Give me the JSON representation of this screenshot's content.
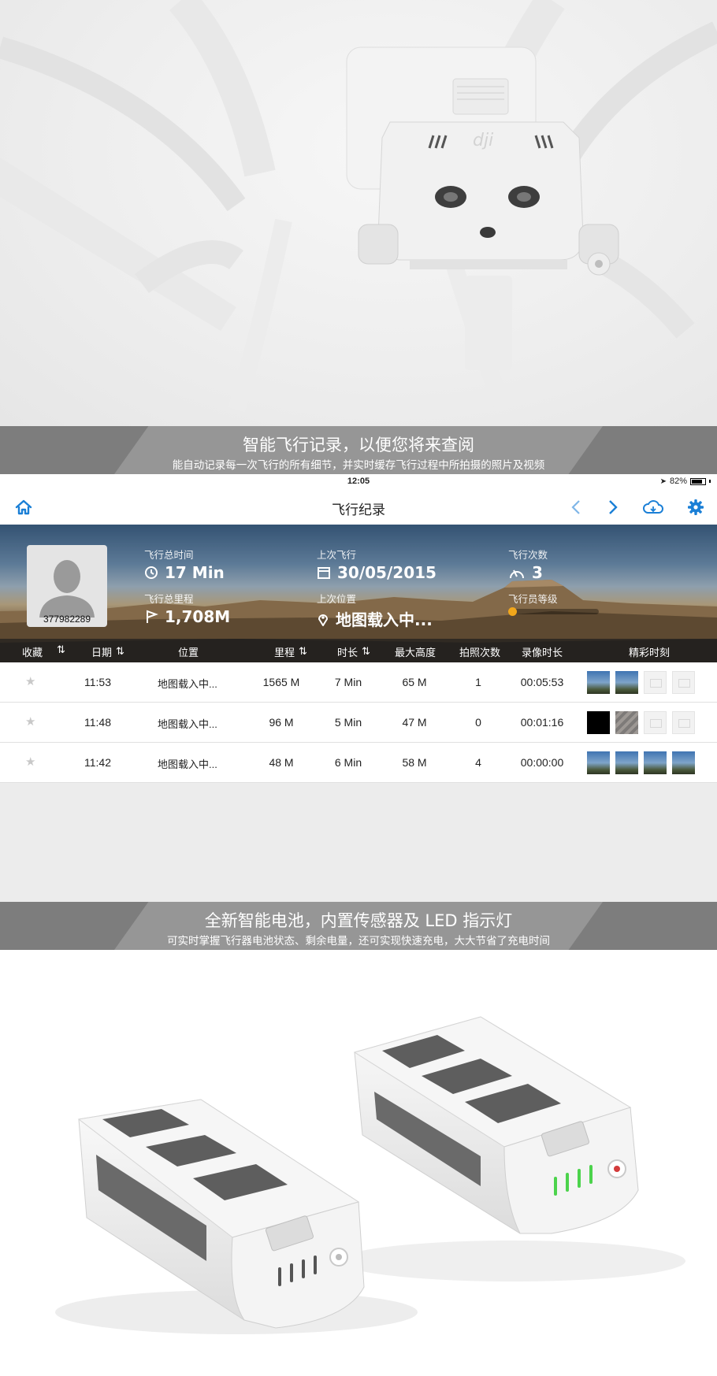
{
  "banner_top": {
    "title": "智能飞行记录，以便您将来查阅",
    "subtitle": "能自动记录每一次飞行的所有细节，并实时缓存飞行过程中所拍摄的照片及视频"
  },
  "status_bar": {
    "time": "12:05",
    "battery": "82%",
    "battery_level": 0.82
  },
  "nav": {
    "title": "飞行纪录",
    "home_icon": "home-icon",
    "prev_icon": "chevron-left-icon",
    "next_icon": "chevron-right-icon",
    "cloud_icon": "cloud-sync-icon",
    "settings_icon": "gear-icon"
  },
  "profile": {
    "user_id": "377982289",
    "total_time_label": "飞行总时间",
    "total_time": "17 Min",
    "last_flight_label": "上次飞行",
    "last_flight": "30/05/2015",
    "flight_count_label": "飞行次数",
    "flight_count": "3",
    "total_distance_label": "飞行总里程",
    "total_distance": "1,708M",
    "last_location_label": "上次位置",
    "last_location": "地图载入中...",
    "pilot_level_label": "飞行员等级"
  },
  "table": {
    "headers": {
      "favorite": "收藏",
      "date": "日期",
      "location": "位置",
      "distance": "里程",
      "duration": "时长",
      "max_altitude": "最大高度",
      "photos": "拍照次数",
      "video_length": "录像时长",
      "highlights": "精彩时刻"
    },
    "rows": [
      {
        "time": "11:53",
        "location": "地图载入中...",
        "distance": "1565 M",
        "duration": "7 Min",
        "altitude": "65 M",
        "photos": "1",
        "video": "00:05:53"
      },
      {
        "time": "11:48",
        "location": "地图载入中...",
        "distance": "96 M",
        "duration": "5 Min",
        "altitude": "47 M",
        "photos": "0",
        "video": "00:01:16"
      },
      {
        "time": "11:42",
        "location": "地图载入中...",
        "distance": "48 M",
        "duration": "6 Min",
        "altitude": "58 M",
        "photos": "4",
        "video": "00:00:00"
      }
    ]
  },
  "banner_bottom": {
    "title": "全新智能电池，内置传感器及 LED 指示灯",
    "subtitle": "可实时掌握飞行器电池状态、剩余电量，还可实现快速充电，大大节省了充电时间"
  },
  "colors": {
    "accent": "#1a7fd6",
    "banner_dark": "#7d7d7d",
    "banner_light": "#969696",
    "level_dot": "#f2a71b",
    "led_green": "#4cd34c"
  }
}
